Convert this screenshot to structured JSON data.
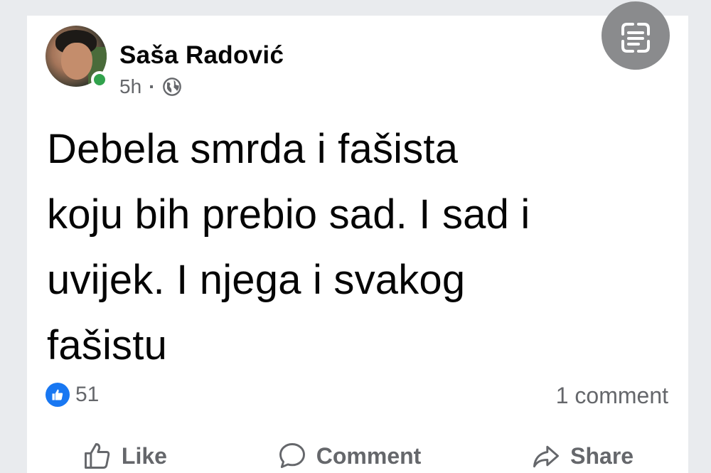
{
  "post": {
    "author": "Saša Radović",
    "time": "5h",
    "separator": "·",
    "visibility_icon": "globe-icon",
    "text_lines": [
      "Debela smrda i fašista",
      "koju bih prebio sad. I sad i",
      "uvijek. I njega i svakog",
      "fašistu"
    ],
    "likes": "51",
    "comments": "1 comment"
  },
  "actions": {
    "like": "Like",
    "comment": "Comment",
    "share": "Share"
  },
  "colors": {
    "brand": "#1877f2",
    "online": "#31a24c",
    "secondary_text": "#65676b",
    "background": "#e9ebee"
  }
}
